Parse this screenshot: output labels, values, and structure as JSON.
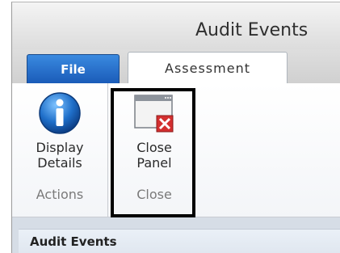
{
  "window": {
    "title": "Audit Events"
  },
  "tabs": [
    {
      "label": "File"
    },
    {
      "label": "Assessment"
    }
  ],
  "ribbon": {
    "groups": [
      {
        "label": "Actions",
        "buttons": [
          {
            "label_line1": "Display",
            "label_line2": "Details",
            "icon": "info-icon"
          }
        ]
      },
      {
        "label": "Close",
        "buttons": [
          {
            "label_line1": "Close",
            "label_line2": "Panel",
            "icon": "close-panel-icon"
          }
        ]
      }
    ]
  },
  "panel": {
    "title": "Audit Events"
  },
  "colors": {
    "file_tab": "#1a5bb8",
    "highlight_border": "#000000",
    "close_red": "#d32f2f"
  }
}
